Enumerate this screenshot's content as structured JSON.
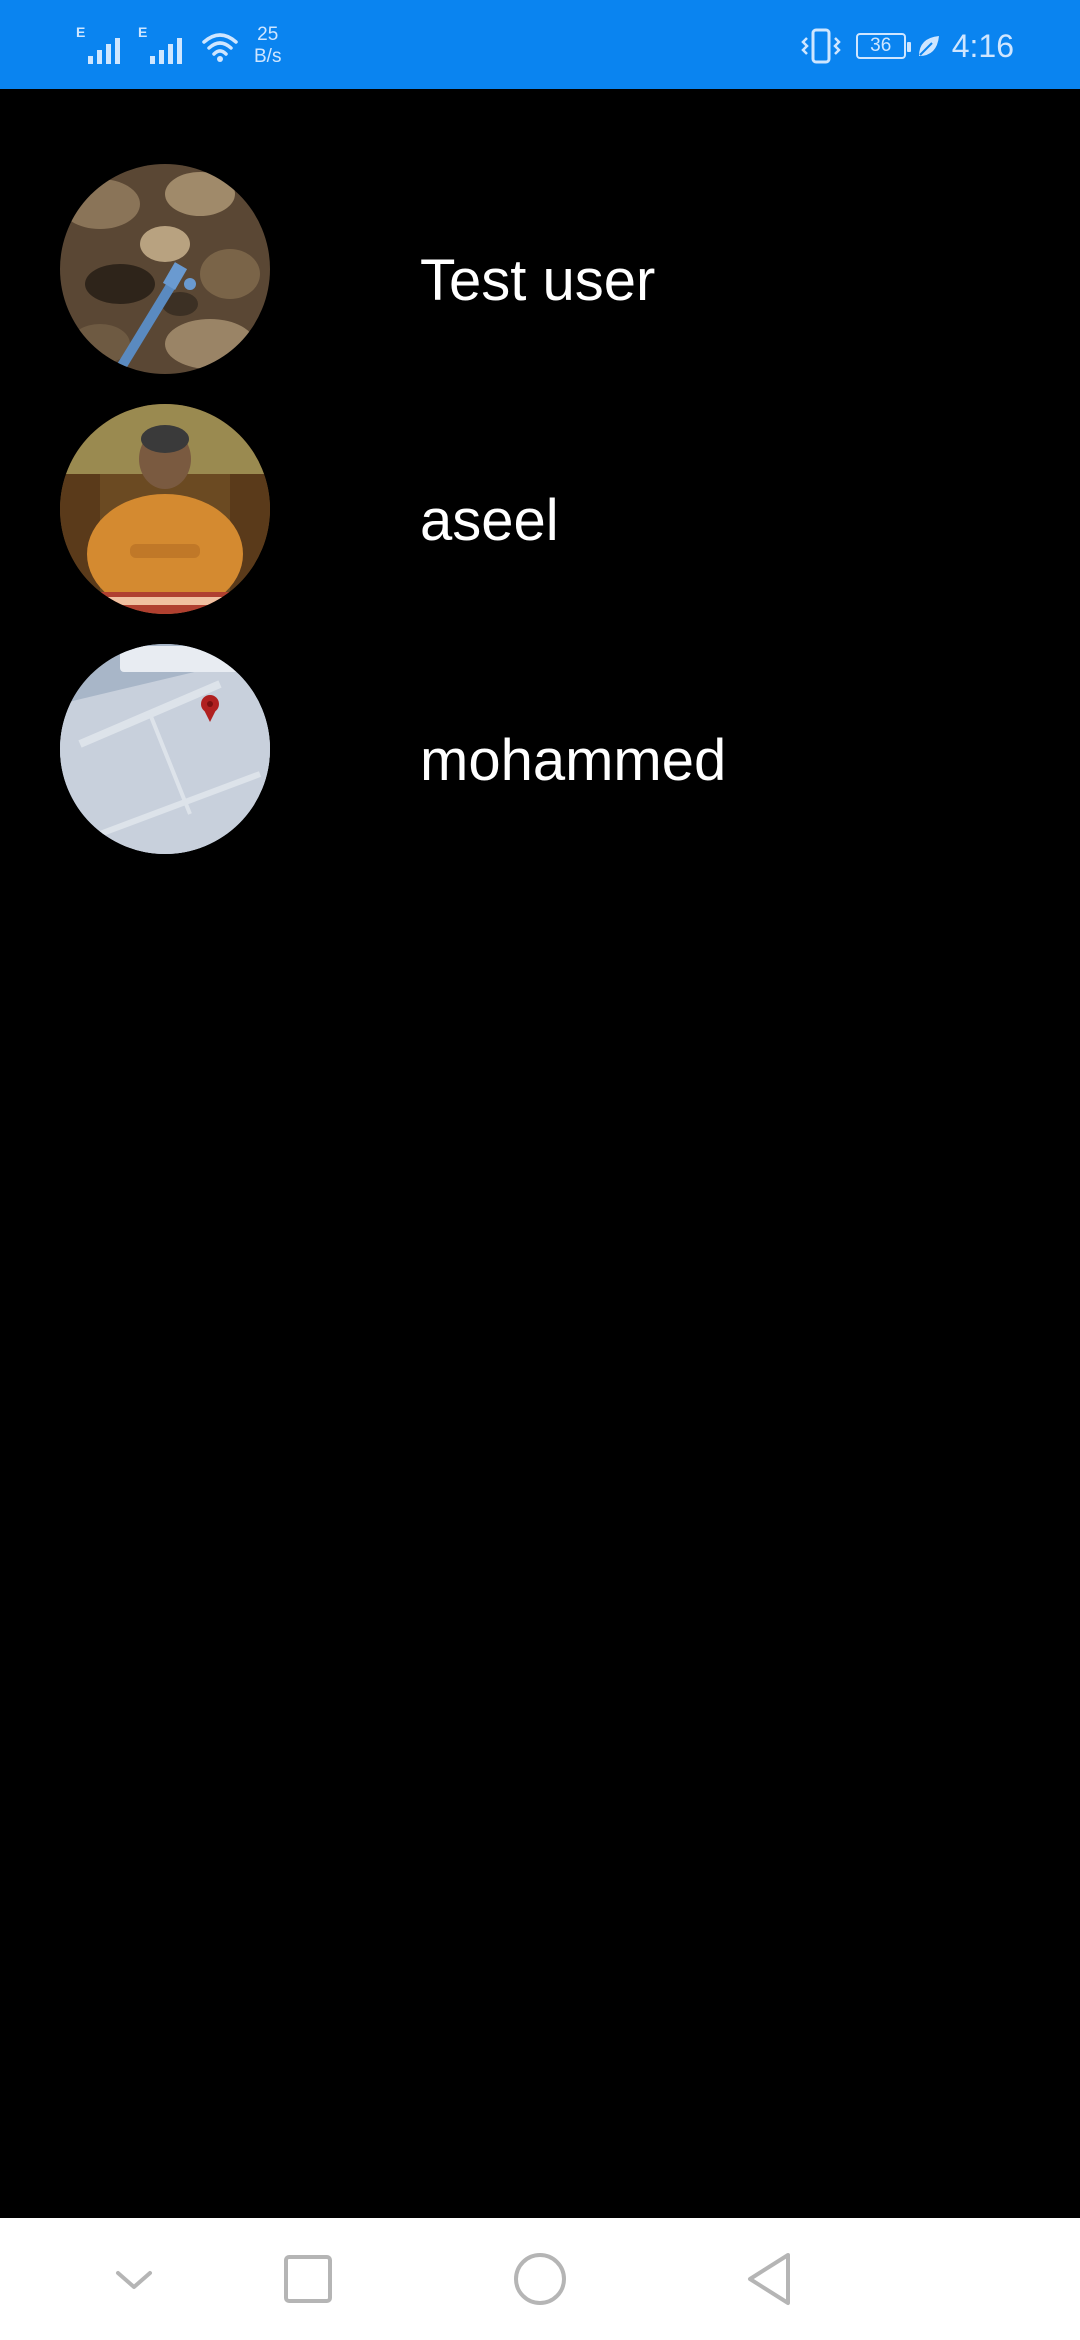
{
  "status_bar": {
    "network_speed_value": "25",
    "network_speed_unit": "B/s",
    "signal_1_type": "E",
    "signal_2_type": "E",
    "battery_level": "36",
    "time": "4:16",
    "color": "#0a84f0"
  },
  "users": [
    {
      "name": "Test user",
      "avatar_icon": "rocky-ground-photo"
    },
    {
      "name": "aseel",
      "avatar_icon": "person-photo"
    },
    {
      "name": "mohammed",
      "avatar_icon": "map-photo"
    }
  ],
  "nav_bar": {
    "buttons": [
      "notification-collapse-icon",
      "recents-icon",
      "home-icon",
      "back-icon"
    ]
  }
}
